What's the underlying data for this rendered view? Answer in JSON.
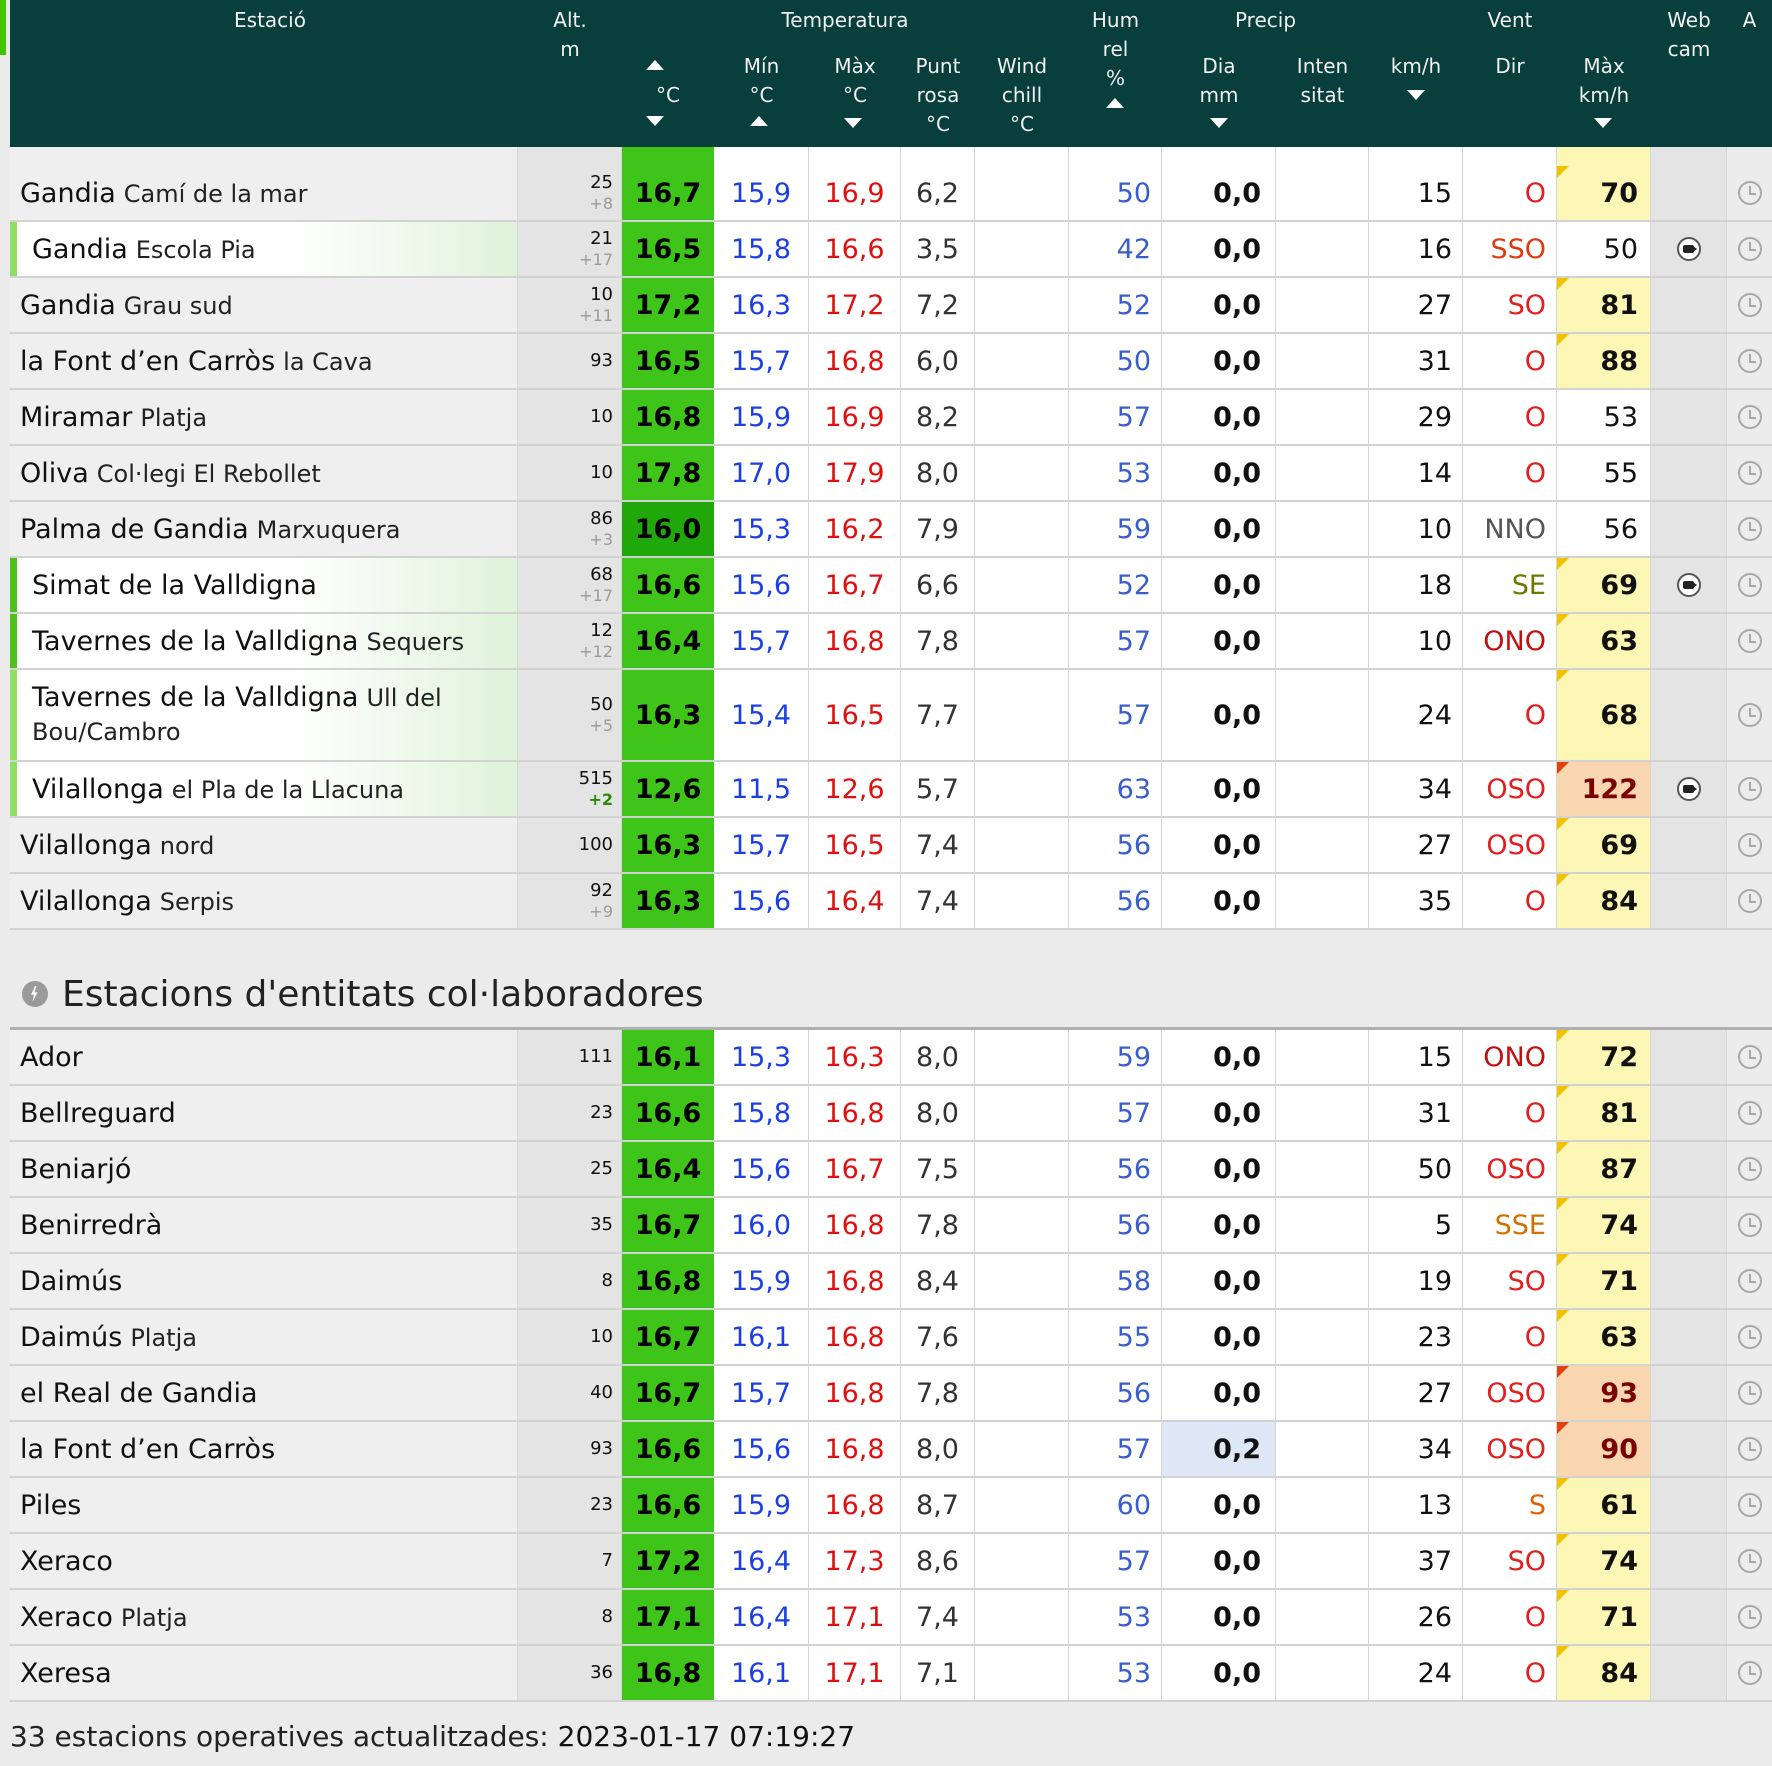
{
  "header": {
    "station": "Estació",
    "alt_line1": "Alt.",
    "alt_line2": "m",
    "temperature_group": "Temperatura",
    "temp_unit": "°C",
    "min_line1": "Mín",
    "min_line2": "°C",
    "max_line1": "Màx",
    "max_line2": "°C",
    "dew_line1": "Punt",
    "dew_line2": "rosa",
    "dew_line3": "°C",
    "wc_line1": "Wind",
    "wc_line2": "chill",
    "wc_line3": "°C",
    "hum_line1": "Hum",
    "hum_line2": "rel",
    "hum_line3": "%",
    "precip_group": "Precip",
    "pday_line1": "Dia",
    "pday_line2": "mm",
    "pint_line1": "Inten",
    "pint_line2": "sitat",
    "wind_group": "Vent",
    "kmh": "km/h",
    "dir": "Dir",
    "gust_line1": "Màx",
    "gust_line2": "km/h",
    "webcam_line1": "Web",
    "webcam_line2": "cam",
    "a": "A"
  },
  "rows_main": [
    {
      "name": "Gandia",
      "sub": "Camí de la mar",
      "alt": "25",
      "alt2": "+8",
      "temp": "16,7",
      "min": "15,9",
      "max": "16,9",
      "dew": "6,2",
      "hum": "50",
      "pday": "0,0",
      "kmh": "15",
      "dir": "O",
      "dir_color": "#e02020",
      "gust": "70",
      "gust_level": "y",
      "cam": false,
      "bar": "",
      "grad": false
    },
    {
      "name": "Gandia",
      "sub": "Escola Pia",
      "alt": "21",
      "alt2": "+17",
      "temp": "16,5",
      "min": "15,8",
      "max": "16,6",
      "dew": "3,5",
      "hum": "42",
      "pday": "0,0",
      "kmh": "16",
      "dir": "SSO",
      "dir_color": "#e03a10",
      "gust": "50",
      "gust_level": "",
      "cam": true,
      "bar": "lt",
      "grad": true
    },
    {
      "name": "Gandia",
      "sub": "Grau sud",
      "alt": "10",
      "alt2": "+11",
      "temp": "17,2",
      "min": "16,3",
      "max": "17,2",
      "dew": "7,2",
      "hum": "52",
      "pday": "0,0",
      "kmh": "27",
      "dir": "SO",
      "dir_color": "#e02020",
      "gust": "81",
      "gust_level": "y",
      "cam": false,
      "bar": "",
      "grad": false
    },
    {
      "name": "la Font d’en Carròs",
      "sub": "la Cava",
      "alt": "93",
      "alt2": "",
      "temp": "16,5",
      "min": "15,7",
      "max": "16,8",
      "dew": "6,0",
      "hum": "50",
      "pday": "0,0",
      "kmh": "31",
      "dir": "O",
      "dir_color": "#e02020",
      "gust": "88",
      "gust_level": "y",
      "cam": false,
      "bar": "",
      "grad": false
    },
    {
      "name": "Miramar",
      "sub": "Platja",
      "alt": "10",
      "alt2": "",
      "temp": "16,8",
      "min": "15,9",
      "max": "16,9",
      "dew": "8,2",
      "hum": "57",
      "pday": "0,0",
      "kmh": "29",
      "dir": "O",
      "dir_color": "#e02020",
      "gust": "53",
      "gust_level": "",
      "cam": false,
      "bar": "",
      "grad": false
    },
    {
      "name": "Oliva",
      "sub": "Col·legi El Rebollet",
      "alt": "10",
      "alt2": "",
      "temp": "17,8",
      "min": "17,0",
      "max": "17,9",
      "dew": "8,0",
      "hum": "53",
      "pday": "0,0",
      "kmh": "14",
      "dir": "O",
      "dir_color": "#e02020",
      "gust": "55",
      "gust_level": "",
      "cam": false,
      "bar": "",
      "grad": false
    },
    {
      "name": "Palma de Gandia",
      "sub": "Marxuquera",
      "alt": "86",
      "alt2": "+3",
      "temp": "16,0",
      "min": "15,3",
      "max": "16,2",
      "dew": "7,9",
      "hum": "59",
      "pday": "0,0",
      "kmh": "10",
      "dir": "NNO",
      "dir_color": "#555555",
      "gust": "56",
      "gust_level": "",
      "cam": false,
      "bar": "",
      "grad": false,
      "dark": true
    },
    {
      "name": "Simat de la Valldigna",
      "sub": "",
      "alt": "68",
      "alt2": "+17",
      "temp": "16,6",
      "min": "15,6",
      "max": "16,7",
      "dew": "6,6",
      "hum": "52",
      "pday": "0,0",
      "kmh": "18",
      "dir": "SE",
      "dir_color": "#6a7a00",
      "gust": "69",
      "gust_level": "y",
      "cam": true,
      "bar": "g",
      "grad": true
    },
    {
      "name": "Tavernes de la Valldigna",
      "sub": "Sequers",
      "alt": "12",
      "alt2": "+12",
      "temp": "16,4",
      "min": "15,7",
      "max": "16,8",
      "dew": "7,8",
      "hum": "57",
      "pday": "0,0",
      "kmh": "10",
      "dir": "ONO",
      "dir_color": "#c01010",
      "gust": "63",
      "gust_level": "y",
      "cam": false,
      "bar": "g",
      "grad": true
    },
    {
      "name": "Tavernes de la Valldigna",
      "sub": "Ull del Bou/Cambro",
      "alt": "50",
      "alt2": "+5",
      "temp": "16,3",
      "min": "15,4",
      "max": "16,5",
      "dew": "7,7",
      "hum": "57",
      "pday": "0,0",
      "kmh": "24",
      "dir": "O",
      "dir_color": "#e02020",
      "gust": "68",
      "gust_level": "y",
      "cam": false,
      "bar": "lt",
      "grad": true,
      "tall": true
    },
    {
      "name": "Vilallonga",
      "sub": "el Pla de la Llacuna",
      "alt": "515",
      "alt2": "+2",
      "alt2_green": true,
      "temp": "12,6",
      "min": "11,5",
      "max": "12,6",
      "dew": "5,7",
      "hum": "63",
      "pday": "0,0",
      "kmh": "34",
      "dir": "OSO",
      "dir_color": "#e02020",
      "gust": "122",
      "gust_level": "o",
      "cam": true,
      "bar": "lt",
      "grad": true
    },
    {
      "name": "Vilallonga",
      "sub": "nord",
      "alt": "100",
      "alt2": "",
      "temp": "16,3",
      "min": "15,7",
      "max": "16,5",
      "dew": "7,4",
      "hum": "56",
      "pday": "0,0",
      "kmh": "27",
      "dir": "OSO",
      "dir_color": "#e02020",
      "gust": "69",
      "gust_level": "y",
      "cam": false,
      "bar": "",
      "grad": false
    },
    {
      "name": "Vilallonga",
      "sub": "Serpis",
      "alt": "92",
      "alt2": "+9",
      "temp": "16,3",
      "min": "15,6",
      "max": "16,4",
      "dew": "7,4",
      "hum": "56",
      "pday": "0,0",
      "kmh": "35",
      "dir": "O",
      "dir_color": "#e02020",
      "gust": "84",
      "gust_level": "y",
      "cam": false,
      "bar": "",
      "grad": false
    }
  ],
  "section_title": "Estacions d'entitats col·laboradores",
  "rows_collab": [
    {
      "name": "Ador",
      "sub": "",
      "alt": "111",
      "temp": "16,1",
      "min": "15,3",
      "max": "16,3",
      "dew": "8,0",
      "hum": "59",
      "pday": "0,0",
      "kmh": "15",
      "dir": "ONO",
      "dir_color": "#c01010",
      "gust": "72",
      "gust_level": "y"
    },
    {
      "name": "Bellreguard",
      "sub": "",
      "alt": "23",
      "temp": "16,6",
      "min": "15,8",
      "max": "16,8",
      "dew": "8,0",
      "hum": "57",
      "pday": "0,0",
      "kmh": "31",
      "dir": "O",
      "dir_color": "#e02020",
      "gust": "81",
      "gust_level": "y"
    },
    {
      "name": "Beniarjó",
      "sub": "",
      "alt": "25",
      "temp": "16,4",
      "min": "15,6",
      "max": "16,7",
      "dew": "7,5",
      "hum": "56",
      "pday": "0,0",
      "kmh": "50",
      "dir": "OSO",
      "dir_color": "#e02020",
      "gust": "87",
      "gust_level": "y"
    },
    {
      "name": "Benirredrà",
      "sub": "",
      "alt": "35",
      "temp": "16,7",
      "min": "16,0",
      "max": "16,8",
      "dew": "7,8",
      "hum": "56",
      "pday": "0,0",
      "kmh": "5",
      "dir": "SSE",
      "dir_color": "#d07000",
      "gust": "74",
      "gust_level": "y"
    },
    {
      "name": "Daimús",
      "sub": "",
      "alt": "8",
      "temp": "16,8",
      "min": "15,9",
      "max": "16,8",
      "dew": "8,4",
      "hum": "58",
      "pday": "0,0",
      "kmh": "19",
      "dir": "SO",
      "dir_color": "#e02020",
      "gust": "71",
      "gust_level": "y"
    },
    {
      "name": "Daimús",
      "sub": "Platja",
      "alt": "10",
      "temp": "16,7",
      "min": "16,1",
      "max": "16,8",
      "dew": "7,6",
      "hum": "55",
      "pday": "0,0",
      "kmh": "23",
      "dir": "O",
      "dir_color": "#e02020",
      "gust": "63",
      "gust_level": "y"
    },
    {
      "name": "el Real de Gandia",
      "sub": "",
      "alt": "40",
      "temp": "16,7",
      "min": "15,7",
      "max": "16,8",
      "dew": "7,8",
      "hum": "56",
      "pday": "0,0",
      "kmh": "27",
      "dir": "OSO",
      "dir_color": "#e02020",
      "gust": "93",
      "gust_level": "o"
    },
    {
      "name": "la Font d’en Carròs",
      "sub": "",
      "alt": "93",
      "temp": "16,6",
      "min": "15,6",
      "max": "16,8",
      "dew": "8,0",
      "hum": "57",
      "pday": "0,2",
      "rain": true,
      "kmh": "34",
      "dir": "OSO",
      "dir_color": "#e02020",
      "gust": "90",
      "gust_level": "o"
    },
    {
      "name": "Piles",
      "sub": "",
      "alt": "23",
      "temp": "16,6",
      "min": "15,9",
      "max": "16,8",
      "dew": "8,7",
      "hum": "60",
      "pday": "0,0",
      "kmh": "13",
      "dir": "S",
      "dir_color": "#e06000",
      "gust": "61",
      "gust_level": "y"
    },
    {
      "name": "Xeraco",
      "sub": "",
      "alt": "7",
      "temp": "17,2",
      "min": "16,4",
      "max": "17,3",
      "dew": "8,6",
      "hum": "57",
      "pday": "0,0",
      "kmh": "37",
      "dir": "SO",
      "dir_color": "#e02020",
      "gust": "74",
      "gust_level": "y"
    },
    {
      "name": "Xeraco",
      "sub": "Platja",
      "alt": "8",
      "temp": "17,1",
      "min": "16,4",
      "max": "17,1",
      "dew": "7,4",
      "hum": "53",
      "pday": "0,0",
      "kmh": "26",
      "dir": "O",
      "dir_color": "#e02020",
      "gust": "71",
      "gust_level": "y"
    },
    {
      "name": "Xeresa",
      "sub": "",
      "alt": "36",
      "temp": "16,8",
      "min": "16,1",
      "max": "17,1",
      "dew": "7,1",
      "hum": "53",
      "pday": "0,0",
      "kmh": "24",
      "dir": "O",
      "dir_color": "#e02020",
      "gust": "84",
      "gust_level": "y"
    }
  ],
  "footer": {
    "text": "33 estacions operatives actualitzades:",
    "timestamp": "2023-01-17 07:19:27"
  }
}
